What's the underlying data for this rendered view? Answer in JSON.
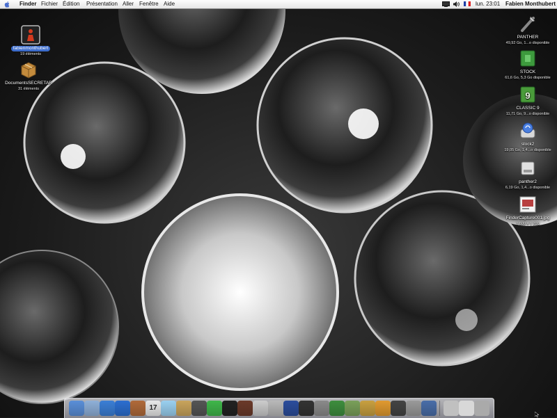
{
  "menubar": {
    "app_name": "Finder",
    "menus": [
      "Fichier",
      "Édition",
      "Présentation",
      "Aller",
      "Fenêtre",
      "Aide"
    ],
    "clock": "lun. 23:01",
    "user": "Fabien  Monthubert"
  },
  "desktop": {
    "left_icons": [
      {
        "label": "fabienmonthubert",
        "sub": "19 éléments",
        "icon": "home-folder-icon",
        "selected": true
      },
      {
        "label": "DocumentsSECRETAR",
        "sub": "31 éléments",
        "icon": "package-box-icon",
        "selected": false
      }
    ],
    "right_icons": [
      {
        "label": "PANTHER",
        "sub": "49,92 Go, 1...o disponible",
        "icon": "startup-disk-icon"
      },
      {
        "label": "STOCK",
        "sub": "61,6 Go, 5,3 Go disponible",
        "icon": "green-drive-icon"
      },
      {
        "label": "CLASSIC 9",
        "sub": "11,71 Go, 9...o disponible",
        "icon": "classic-drive-icon"
      },
      {
        "label": "stock2",
        "sub": "19,05 Go, 1,4...o disponible",
        "icon": "firewire-drive-icon"
      },
      {
        "label": "panther2",
        "sub": "6,19 Go, 1,4...o disponible",
        "icon": "internal-drive-icon"
      },
      {
        "label": "FinderCapture001.jpg",
        "sub": "1 600 x 1 200",
        "icon": "jpeg-file-icon"
      }
    ]
  },
  "dock": {
    "calendar_date": "17",
    "items": [
      {
        "name": "finder-dock-icon",
        "color": "#5a8fd8"
      },
      {
        "name": "mail-dock-icon",
        "color": "#8fb0d8"
      },
      {
        "name": "safari-dock-icon",
        "color": "#3b7fd6"
      },
      {
        "name": "internet-explorer-dock-icon",
        "color": "#2c6fd0"
      },
      {
        "name": "address-book-dock-icon",
        "color": "#b06a3a"
      },
      {
        "name": "ical-dock-icon",
        "color": "#e8e8e8"
      },
      {
        "name": "itunes-dock-icon",
        "color": "#9ad0f0"
      },
      {
        "name": "iphoto-dock-icon",
        "color": "#c9a45c"
      },
      {
        "name": "calculator-dock-icon",
        "color": "#555555"
      },
      {
        "name": "skype-dock-icon",
        "color": "#3fb64a"
      },
      {
        "name": "terminal-dock-icon",
        "color": "#222222"
      },
      {
        "name": "app-dock-icon-1",
        "color": "#6b3a2a"
      },
      {
        "name": "disk-utility-dock-icon",
        "color": "#cccccc"
      },
      {
        "name": "photo-dock-icon",
        "color": "#b9b9b9"
      },
      {
        "name": "imovie-dock-icon",
        "color": "#2b4d9c"
      },
      {
        "name": "clapper-dock-icon",
        "color": "#333333"
      },
      {
        "name": "tool-dock-icon",
        "color": "#8a8a8a"
      },
      {
        "name": "graphic-dock-icon",
        "color": "#3e8e3e"
      },
      {
        "name": "pen-dock-icon",
        "color": "#7aa05a"
      },
      {
        "name": "network-dock-icon",
        "color": "#c8a040"
      },
      {
        "name": "chat-dock-icon",
        "color": "#e09a30"
      },
      {
        "name": "x11-dock-icon",
        "color": "#444444"
      },
      {
        "name": "system-prefs-dock-icon",
        "color": "#9a9a9a"
      },
      {
        "name": "folder-dock-icon",
        "color": "#4a6ea8"
      }
    ],
    "trailing": [
      {
        "name": "disc-dock-icon",
        "color": "#c0c0c0"
      },
      {
        "name": "documents-dock-icon",
        "color": "#d8d8d8"
      },
      {
        "name": "trash-dock-icon",
        "color": "#aaaaaa"
      }
    ]
  }
}
